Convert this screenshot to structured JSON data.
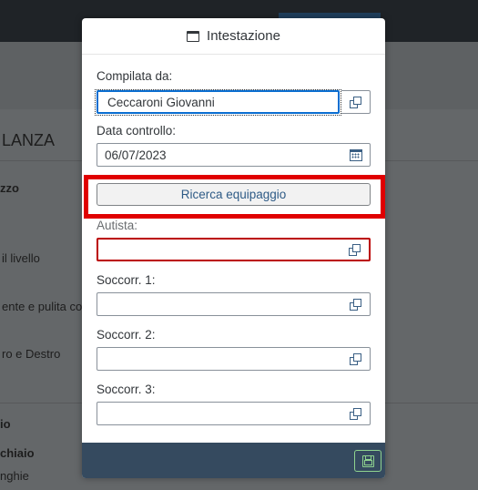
{
  "background": {
    "title": "LANZA",
    "row1": "zzo",
    "row2": "il livello",
    "row3": "ente e pulita co",
    "row4": "ro e Destro",
    "row5": "io",
    "row6": "chiaio",
    "row7": "nghie"
  },
  "dialog": {
    "title": "Intestazione",
    "compilata_label": "Compilata da:",
    "compilata_value": "Ceccaroni Giovanni",
    "data_label": "Data controllo:",
    "data_value": "06/07/2023",
    "search_button": "Ricerca equipaggio",
    "autista_label": "Autista:",
    "autista_value": "",
    "soccorr1_label": "Soccorr. 1:",
    "soccorr1_value": "",
    "soccorr2_label": "Soccorr. 2:",
    "soccorr2_value": "",
    "soccorr3_label": "Soccorr. 3:",
    "soccorr3_value": ""
  },
  "colors": {
    "highlight": "#e00000",
    "footer": "#354a5f",
    "focus": "#0a6ed1",
    "error": "#bb0000"
  },
  "icons": {
    "header": "window-icon",
    "value_help": "value-help-icon",
    "date": "calendar-icon",
    "save": "save-icon"
  }
}
